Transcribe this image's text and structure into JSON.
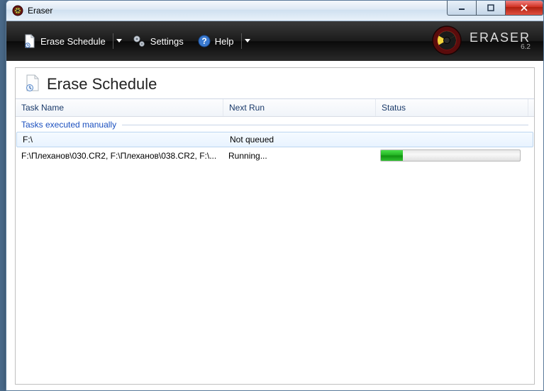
{
  "window": {
    "title": "Eraser"
  },
  "toolbar": {
    "erase_schedule": "Erase Schedule",
    "settings": "Settings",
    "help": "Help"
  },
  "brand": {
    "name": "ERASER",
    "version": "6.2"
  },
  "page": {
    "title": "Erase Schedule"
  },
  "columns": {
    "task": "Task Name",
    "next": "Next Run",
    "status": "Status"
  },
  "group": {
    "label": "Tasks executed manually"
  },
  "rows": [
    {
      "task": "F:\\",
      "next": "Not queued",
      "status": "",
      "selected": true,
      "progress": null
    },
    {
      "task": "F:\\Плеханов\\030.CR2, F:\\Плеханов\\038.CR2, F:\\...",
      "next": "Running...",
      "status": "",
      "selected": false,
      "progress": 16
    }
  ]
}
